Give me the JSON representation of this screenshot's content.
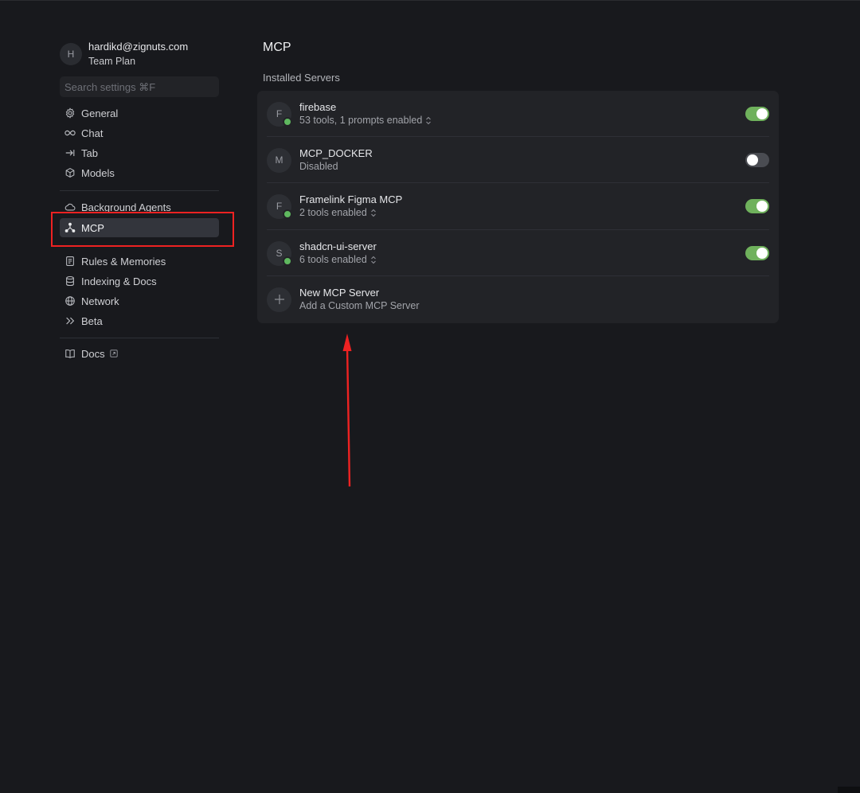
{
  "user": {
    "initial": "H",
    "email": "hardikd@zignuts.com",
    "plan": "Team Plan"
  },
  "search": {
    "placeholder": "Search settings ⌘F"
  },
  "nav": {
    "group1": [
      {
        "label": "General",
        "icon": "gear-icon"
      },
      {
        "label": "Chat",
        "icon": "infinity-icon"
      },
      {
        "label": "Tab",
        "icon": "tab-arrow-icon"
      },
      {
        "label": "Models",
        "icon": "cube-icon"
      }
    ],
    "group2": [
      {
        "label": "Background Agents",
        "icon": "cloud-icon"
      },
      {
        "label": "MCP",
        "icon": "mcp-nodes-icon",
        "active": true
      }
    ],
    "group3": [
      {
        "label": "Rules & Memories",
        "icon": "document-icon"
      },
      {
        "label": "Indexing & Docs",
        "icon": "database-icon"
      },
      {
        "label": "Network",
        "icon": "globe-icon"
      },
      {
        "label": "Beta",
        "icon": "double-chevron-icon"
      }
    ],
    "group4": [
      {
        "label": "Docs",
        "icon": "book-icon"
      }
    ]
  },
  "main": {
    "title": "MCP",
    "section_label": "Installed Servers",
    "servers": [
      {
        "initial": "F",
        "name": "firebase",
        "subtitle": "53 tools, 1 prompts enabled",
        "enabled": true,
        "status": "green"
      },
      {
        "initial": "M",
        "name": "MCP_DOCKER",
        "subtitle": "Disabled",
        "enabled": false,
        "status": "none"
      },
      {
        "initial": "F",
        "name": "Framelink Figma MCP",
        "subtitle": "2 tools enabled",
        "enabled": true,
        "status": "green"
      },
      {
        "initial": "S",
        "name": "shadcn-ui-server",
        "subtitle": "6 tools enabled",
        "enabled": true,
        "status": "green"
      }
    ],
    "new_server": {
      "title": "New MCP Server",
      "subtitle": "Add a Custom MCP Server"
    }
  },
  "colors": {
    "background": "#18191d",
    "panel": "#222327",
    "toggle_on": "#6fb15c",
    "toggle_off": "#4a4c52",
    "status_green": "#5fb85f",
    "annotation_red": "#ee2222"
  }
}
